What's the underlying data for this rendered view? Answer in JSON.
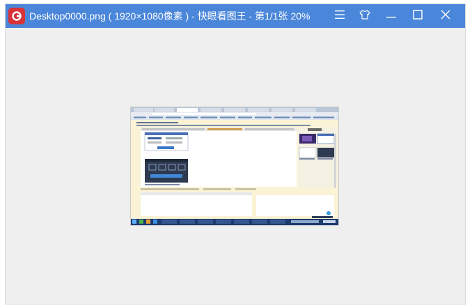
{
  "window": {
    "title": "Desktop0000.png ( 1920×1080像素 ) - 快眼看图王 - 第1/1张 20%"
  },
  "icons": {
    "app_logo": "kuaiyan-logo-icon",
    "menu": "hamburger-menu-icon",
    "skin": "tshirt-skin-icon",
    "minimize": "minimize-icon",
    "maximize": "maximize-icon",
    "close": "close-icon"
  },
  "colors": {
    "titlebar": "#4a86d9",
    "logo": "#d9333a",
    "canvas": "#efefef"
  }
}
